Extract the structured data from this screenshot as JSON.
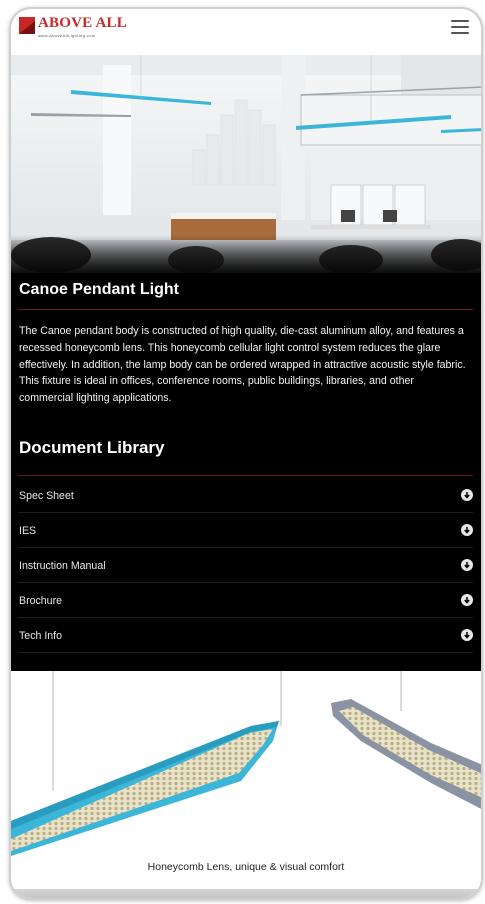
{
  "brand": {
    "name": "ABOVE ALL",
    "tagline": "www.AboveAllLighting.com",
    "color": "#c62828"
  },
  "header": {
    "menu_icon": "hamburger-menu-icon"
  },
  "product": {
    "title": "Canoe Pendant Light",
    "description": "The Canoe pendant body is constructed of high quality, die-cast aluminum alloy, and features a recessed honeycomb lens. This honeycomb cellular light control system reduces the glare effectively. In addition, the lamp body can be ordered wrapped in attractive acoustic style fabric. This fixture is ideal in offices, conference rooms, public buildings, libraries, and other commercial lighting applications."
  },
  "library": {
    "title": "Document Library",
    "items": [
      {
        "label": "Spec Sheet",
        "icon": "arrow-down-circle-icon"
      },
      {
        "label": "IES",
        "icon": "arrow-down-circle-icon"
      },
      {
        "label": "Instruction Manual",
        "icon": "arrow-down-circle-icon"
      },
      {
        "label": "Brochure",
        "icon": "arrow-down-circle-icon"
      },
      {
        "label": "Tech Info",
        "icon": "arrow-down-circle-icon"
      }
    ]
  },
  "feature": {
    "caption": "Honeycomb Lens, unique & visual comfort"
  },
  "colors": {
    "panel": "#000000",
    "fixture_blue": "#3bb6d8",
    "fixture_gray": "#8a93a3"
  }
}
